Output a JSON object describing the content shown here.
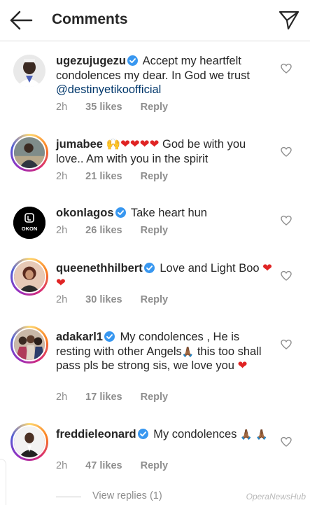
{
  "header": {
    "title": "Comments"
  },
  "comments": [
    {
      "username": "ugezujugezu",
      "verified": true,
      "text": "Accept my heartfelt condolences my dear. In God we trust",
      "mention": "@destinyetikoofficial",
      "time": "2h",
      "likes": "35 likes",
      "reply": "Reply"
    },
    {
      "username": "jumabee",
      "verified": false,
      "prefix_emoji": "🙌",
      "hearts": "❤❤❤❤",
      "text": "God be with you love.. Am with you in the spirit",
      "time": "2h",
      "likes": "21 likes",
      "reply": "Reply"
    },
    {
      "username": "okonlagos",
      "verified": true,
      "avatar_label": "OKON",
      "text": "Take heart hun",
      "time": "2h",
      "likes": "26 likes",
      "reply": "Reply"
    },
    {
      "username": "queenethhilbert",
      "verified": true,
      "text": "Love and Light Boo",
      "hearts": "❤❤",
      "time": "2h",
      "likes": "30 likes",
      "reply": "Reply"
    },
    {
      "username": "adakarl1",
      "verified": true,
      "text_a": "My condolences , He is resting with other Angels",
      "emoji_a": "🙏🏾",
      "text_b": "this too shall pass pls be strong sis, we love you",
      "hearts": "❤",
      "time": "2h",
      "likes": "17 likes",
      "reply": "Reply"
    },
    {
      "username": "freddieleonard",
      "verified": true,
      "text": "My condolences",
      "emoji_a": "🙏🏾",
      "emoji_b": "🙏🏾",
      "time": "2h",
      "likes": "47 likes",
      "reply": "Reply"
    }
  ],
  "view_replies": "View replies (1)",
  "watermark": "OperaNewsHub",
  "colors": {
    "verified": "#3897f0",
    "heart": "#e02424",
    "meta": "#8e8e8e",
    "mention": "#00376b"
  }
}
